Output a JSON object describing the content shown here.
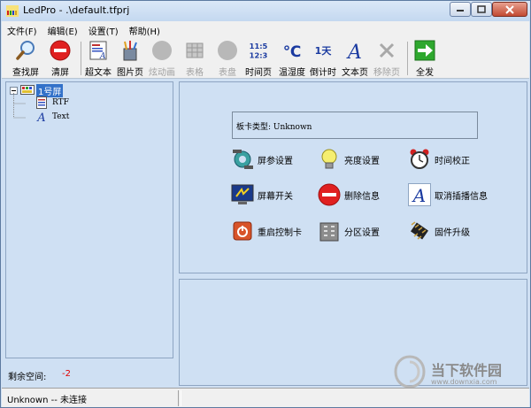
{
  "titlebar": {
    "title": "LedPro - .\\default.tfprj"
  },
  "menubar": {
    "items": [
      "文件(F)",
      "编辑(E)",
      "设置(T)",
      "帮助(H)"
    ]
  },
  "toolbar": {
    "buttons": [
      {
        "label": "查找屏",
        "icon": "magnifier-icon",
        "enabled": true
      },
      {
        "label": "清屏",
        "icon": "clear-screen-icon",
        "enabled": true
      },
      {
        "label": "超文本",
        "icon": "hypertext-icon",
        "enabled": true
      },
      {
        "label": "图片页",
        "icon": "picture-page-icon",
        "enabled": true
      },
      {
        "label": "炫动画",
        "icon": "animation-icon",
        "enabled": false
      },
      {
        "label": "表格",
        "icon": "table-icon",
        "enabled": false
      },
      {
        "label": "表盘",
        "icon": "dial-icon",
        "enabled": false
      },
      {
        "label": "时间页",
        "icon": "time-page-icon",
        "enabled": true,
        "glyph": "11:5 12:3"
      },
      {
        "label": "温湿度",
        "icon": "temperature-icon",
        "enabled": true,
        "glyph": "℃"
      },
      {
        "label": "倒计时",
        "icon": "countdown-icon",
        "enabled": true,
        "glyph": "1天"
      },
      {
        "label": "文本页",
        "icon": "text-page-icon",
        "enabled": true,
        "glyph": "A"
      },
      {
        "label": "移除页",
        "icon": "remove-page-icon",
        "enabled": false,
        "glyph": "✕"
      },
      {
        "label": "全发",
        "icon": "send-all-icon",
        "enabled": true
      }
    ]
  },
  "tree": {
    "root": "1号屏",
    "children": [
      {
        "label": "RTF",
        "icon": "rtf-doc-icon"
      },
      {
        "label": "Text",
        "icon": "text-a-icon"
      }
    ]
  },
  "left_footer": {
    "label": "剩余空间:",
    "value": "-2"
  },
  "card_type": {
    "text": "板卡类型: Unknown"
  },
  "actions": {
    "screen_params": "屏参设置",
    "brightness": "亮度设置",
    "time_calibration": "时间校正",
    "screen_switch": "屏幕开关",
    "delete_info": "删除信息",
    "cancel_insert": "取消插播信息",
    "restart_card": "重启控制卡",
    "zone_settings": "分区设置",
    "firmware_upgrade": "固件升级"
  },
  "statusbar": {
    "text": "Unknown -- 未连接"
  },
  "watermark": {
    "brand": "当下软件园",
    "url": "www.downxia.com"
  },
  "colors": {
    "accent": "#3271c9",
    "window_bg": "#cfe0f3",
    "warning_red": "#e00000"
  }
}
